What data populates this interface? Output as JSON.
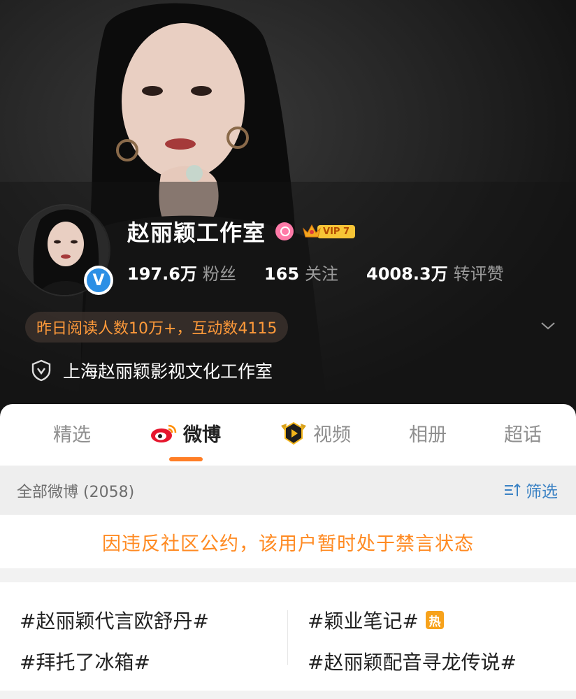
{
  "profile": {
    "name": "赵丽颖工作室",
    "vip_label": "VIP 7",
    "verified_mark": "V",
    "stats": [
      {
        "value": "197.6万",
        "label": "粉丝"
      },
      {
        "value": "165",
        "label": "关注"
      },
      {
        "value": "4008.3万",
        "label": "转评赞"
      }
    ],
    "reads_summary": "昨日阅读人数10万+，互动数4115",
    "organization": "上海赵丽颖影视文化工作室"
  },
  "tabs": [
    {
      "label": "精选",
      "icon": null,
      "active": false
    },
    {
      "label": "微博",
      "icon": "weibo-icon",
      "active": true
    },
    {
      "label": "视频",
      "icon": "video-icon",
      "active": false
    },
    {
      "label": "相册",
      "icon": null,
      "active": false
    },
    {
      "label": "超话",
      "icon": null,
      "active": false
    }
  ],
  "filter": {
    "all_posts": "全部微博 (2058)",
    "filter_label": "筛选"
  },
  "notice": "因违反社区公约，该用户暂时处于禁言状态",
  "topics": [
    {
      "text": "#赵丽颖代言欧舒丹#",
      "badge": null
    },
    {
      "text": "#颖业笔记#",
      "badge": "热"
    },
    {
      "text": "#拜托了冰箱#",
      "badge": null
    },
    {
      "text": "#赵丽颖配音寻龙传说#",
      "badge": null
    }
  ],
  "colors": {
    "accent_orange": "#ff7e26",
    "notice_orange": "#ff8a22",
    "link_blue": "#3b82c4",
    "verified_blue": "#2b8fe5",
    "vip_gold": "#f7c536"
  }
}
